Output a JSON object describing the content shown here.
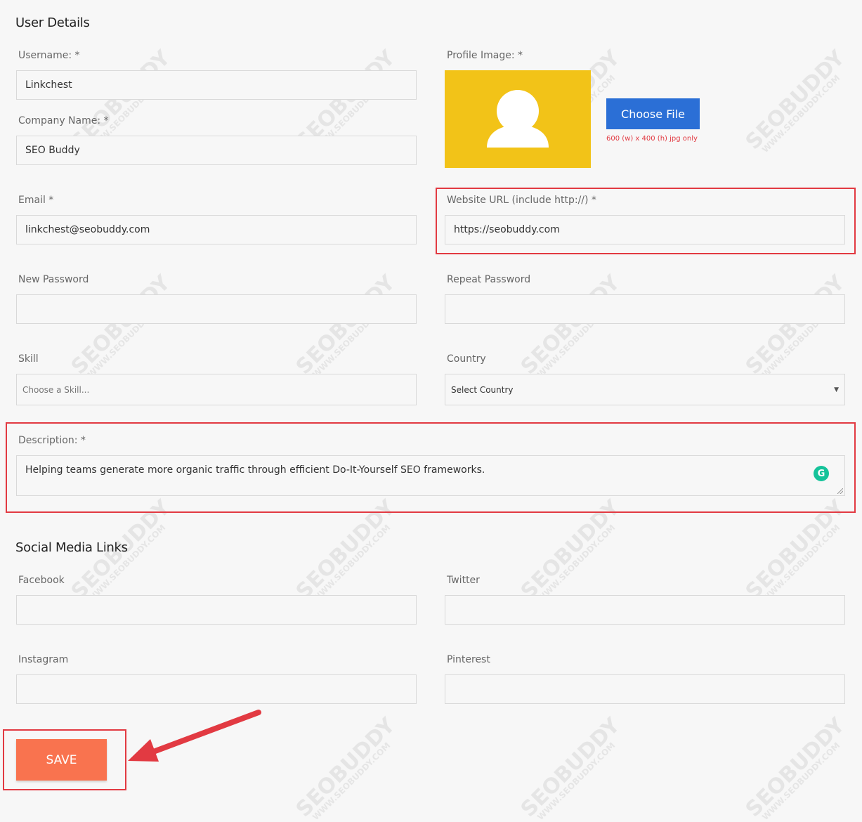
{
  "user_details": {
    "title": "User Details",
    "username": {
      "label": "Username: *",
      "value": "Linkchest"
    },
    "company": {
      "label": "Company Name: *",
      "value": "SEO Buddy"
    },
    "profile_image": {
      "label": "Profile Image: *",
      "button": "Choose File",
      "hint": "600 (w) x 400 (h) jpg only"
    },
    "email": {
      "label": "Email *",
      "value": "linkchest@seobuddy.com"
    },
    "website": {
      "label": "Website URL (include http://) *",
      "value": "https://seobuddy.com"
    },
    "new_password": {
      "label": "New Password",
      "value": ""
    },
    "repeat_password": {
      "label": "Repeat Password",
      "value": ""
    },
    "skill": {
      "label": "Skill",
      "placeholder": "Choose a Skill..."
    },
    "country": {
      "label": "Country",
      "selected": "Select Country"
    },
    "description": {
      "label": "Description: *",
      "value": "Helping teams generate more organic traffic through efficient Do-It-Yourself SEO frameworks."
    }
  },
  "social": {
    "title": "Social Media Links",
    "facebook": {
      "label": "Facebook",
      "value": ""
    },
    "twitter": {
      "label": "Twitter",
      "value": ""
    },
    "instagram": {
      "label": "Instagram",
      "value": ""
    },
    "pinterest": {
      "label": "Pinterest",
      "value": ""
    }
  },
  "save_label": "SAVE",
  "watermark": {
    "brand": "SEOBUDDY",
    "url": "WWW.SEOBUDDY.COM"
  },
  "colors": {
    "highlight": "#e23a42",
    "avatar_bg": "#f2c318",
    "choose_button": "#2b6fd6",
    "save_button": "#f9734f",
    "hint": "#e23a42",
    "grammarly": "#15c39a"
  },
  "icons": [
    "user-silhouette-icon",
    "grammarly-icon",
    "dropdown-caret-icon",
    "arrow-annotation-icon"
  ]
}
